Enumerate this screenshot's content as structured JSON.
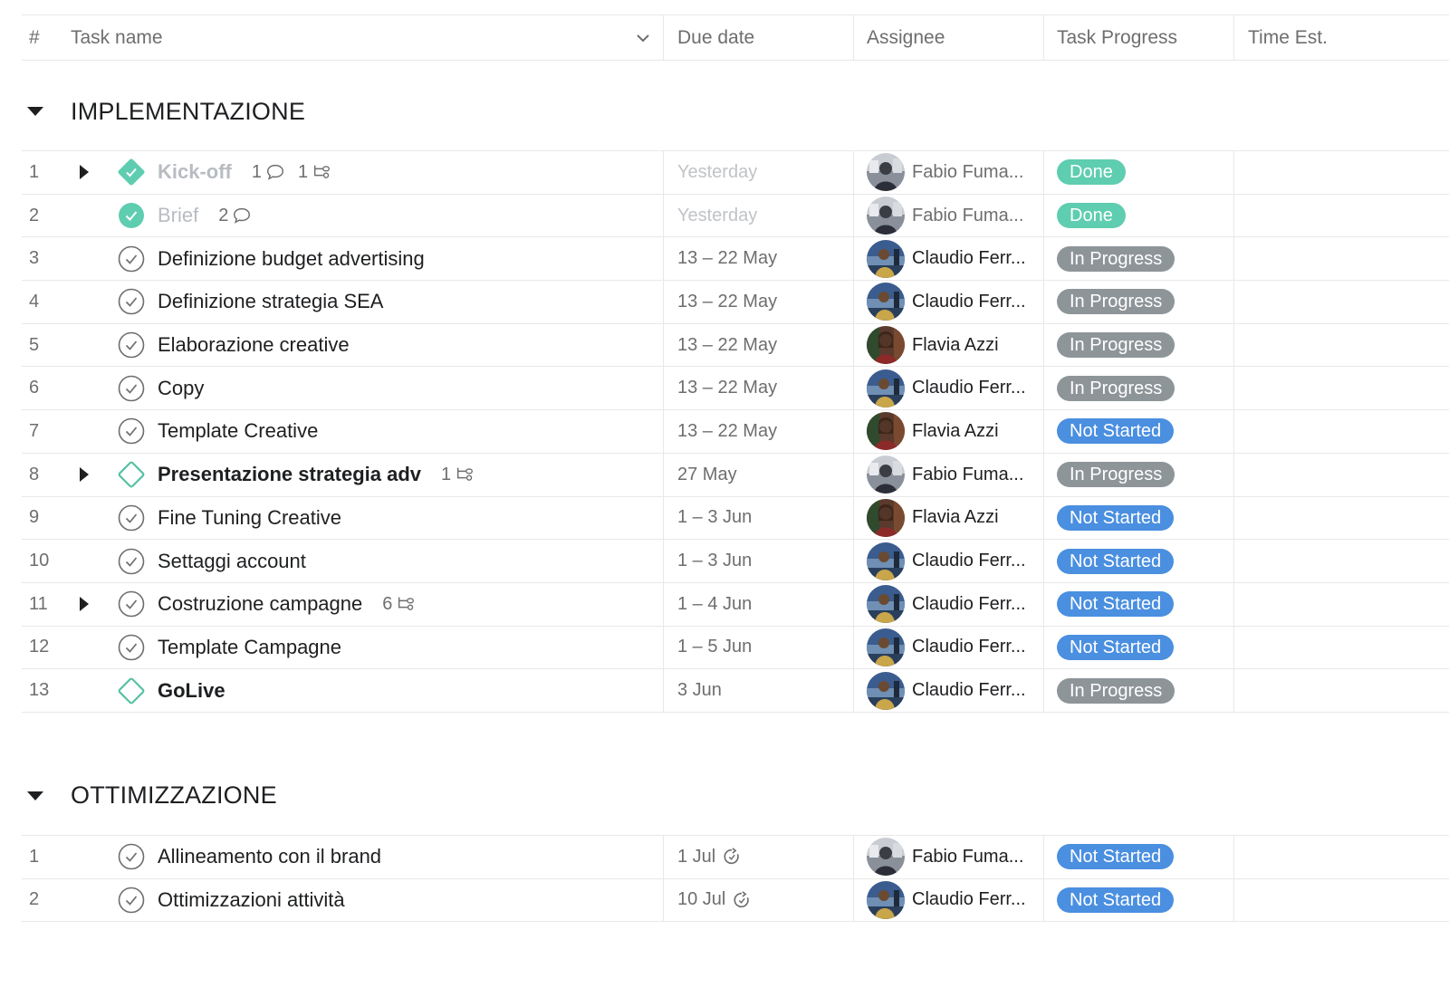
{
  "header": {
    "hash": "#",
    "task_name": "Task name",
    "due_date": "Due date",
    "assignee": "Assignee",
    "task_progress": "Task Progress",
    "time_est": "Time Est."
  },
  "colors": {
    "done": "#5fcdb0",
    "in_progress": "#8e9599",
    "not_started": "#4a8fe0",
    "milestone": "#58c1a4"
  },
  "sections": [
    {
      "title": "IMPLEMENTAZIONE",
      "tasks": [
        {
          "num": "1",
          "name": "Kick-off",
          "icon": "milestone-done-icon",
          "expandable": true,
          "bold": true,
          "done": true,
          "comments": "1",
          "subtasks": "1",
          "due": "Yesterday",
          "due_muted": true,
          "assignee": "Fabio Fuma...",
          "avatar": "fabio",
          "status": "Done",
          "status_key": "done"
        },
        {
          "num": "2",
          "name": "Brief",
          "icon": "check-done-icon",
          "expandable": false,
          "bold": false,
          "done": true,
          "comments": "2",
          "due": "Yesterday",
          "due_muted": true,
          "assignee": "Fabio Fuma...",
          "avatar": "fabio",
          "status": "Done",
          "status_key": "done"
        },
        {
          "num": "3",
          "name": "Definizione budget advertising",
          "icon": "check-circle-icon",
          "due": "13 – 22 May",
          "assignee": "Claudio Ferr...",
          "avatar": "claudio",
          "status": "In Progress",
          "status_key": "in_progress"
        },
        {
          "num": "4",
          "name": "Definizione strategia SEA",
          "icon": "check-circle-icon",
          "due": "13 – 22 May",
          "assignee": "Claudio Ferr...",
          "avatar": "claudio",
          "status": "In Progress",
          "status_key": "in_progress"
        },
        {
          "num": "5",
          "name": "Elaborazione creative",
          "icon": "check-circle-icon",
          "due": "13 – 22 May",
          "assignee": "Flavia Azzi",
          "avatar": "flavia",
          "status": "In Progress",
          "status_key": "in_progress"
        },
        {
          "num": "6",
          "name": "Copy",
          "icon": "check-circle-icon",
          "due": "13 – 22 May",
          "assignee": "Claudio Ferr...",
          "avatar": "claudio",
          "status": "In Progress",
          "status_key": "in_progress"
        },
        {
          "num": "7",
          "name": "Template Creative",
          "icon": "check-circle-icon",
          "due": "13 – 22 May",
          "assignee": "Flavia Azzi",
          "avatar": "flavia",
          "status": "Not Started",
          "status_key": "not_started"
        },
        {
          "num": "8",
          "name": "Presentazione strategia adv",
          "icon": "milestone-icon",
          "expandable": true,
          "bold": true,
          "subtasks": "1",
          "due": "27 May",
          "assignee": "Fabio Fuma...",
          "avatar": "fabio",
          "status": "In Progress",
          "status_key": "in_progress"
        },
        {
          "num": "9",
          "name": "Fine Tuning Creative",
          "icon": "check-circle-icon",
          "due": "1 – 3 Jun",
          "assignee": "Flavia Azzi",
          "avatar": "flavia",
          "status": "Not Started",
          "status_key": "not_started"
        },
        {
          "num": "10",
          "name": "Settaggi account",
          "icon": "check-circle-icon",
          "due": "1 – 3 Jun",
          "assignee": "Claudio Ferr...",
          "avatar": "claudio",
          "status": "Not Started",
          "status_key": "not_started"
        },
        {
          "num": "11",
          "name": "Costruzione campagne",
          "icon": "check-circle-icon",
          "expandable": true,
          "subtasks": "6",
          "due": "1 – 4 Jun",
          "assignee": "Claudio Ferr...",
          "avatar": "claudio",
          "status": "Not Started",
          "status_key": "not_started"
        },
        {
          "num": "12",
          "name": "Template Campagne",
          "icon": "check-circle-icon",
          "due": "1 – 5 Jun",
          "assignee": "Claudio Ferr...",
          "avatar": "claudio",
          "status": "Not Started",
          "status_key": "not_started"
        },
        {
          "num": "13",
          "name": "GoLive",
          "icon": "milestone-icon",
          "bold": true,
          "due": "3 Jun",
          "assignee": "Claudio Ferr...",
          "avatar": "claudio",
          "status": "In Progress",
          "status_key": "in_progress"
        }
      ]
    },
    {
      "title": "OTTIMIZZAZIONE",
      "tasks": [
        {
          "num": "1",
          "name": "Allineamento con il brand",
          "icon": "check-circle-icon",
          "due": "1 Jul",
          "recurring": true,
          "assignee": "Fabio Fuma...",
          "avatar": "fabio",
          "status": "Not Started",
          "status_key": "not_started"
        },
        {
          "num": "2",
          "name": "Ottimizzazioni attività",
          "icon": "check-circle-icon",
          "due": "10 Jul",
          "recurring": true,
          "assignee": "Claudio Ferr...",
          "avatar": "claudio",
          "status": "Not Started",
          "status_key": "not_started"
        }
      ]
    }
  ]
}
